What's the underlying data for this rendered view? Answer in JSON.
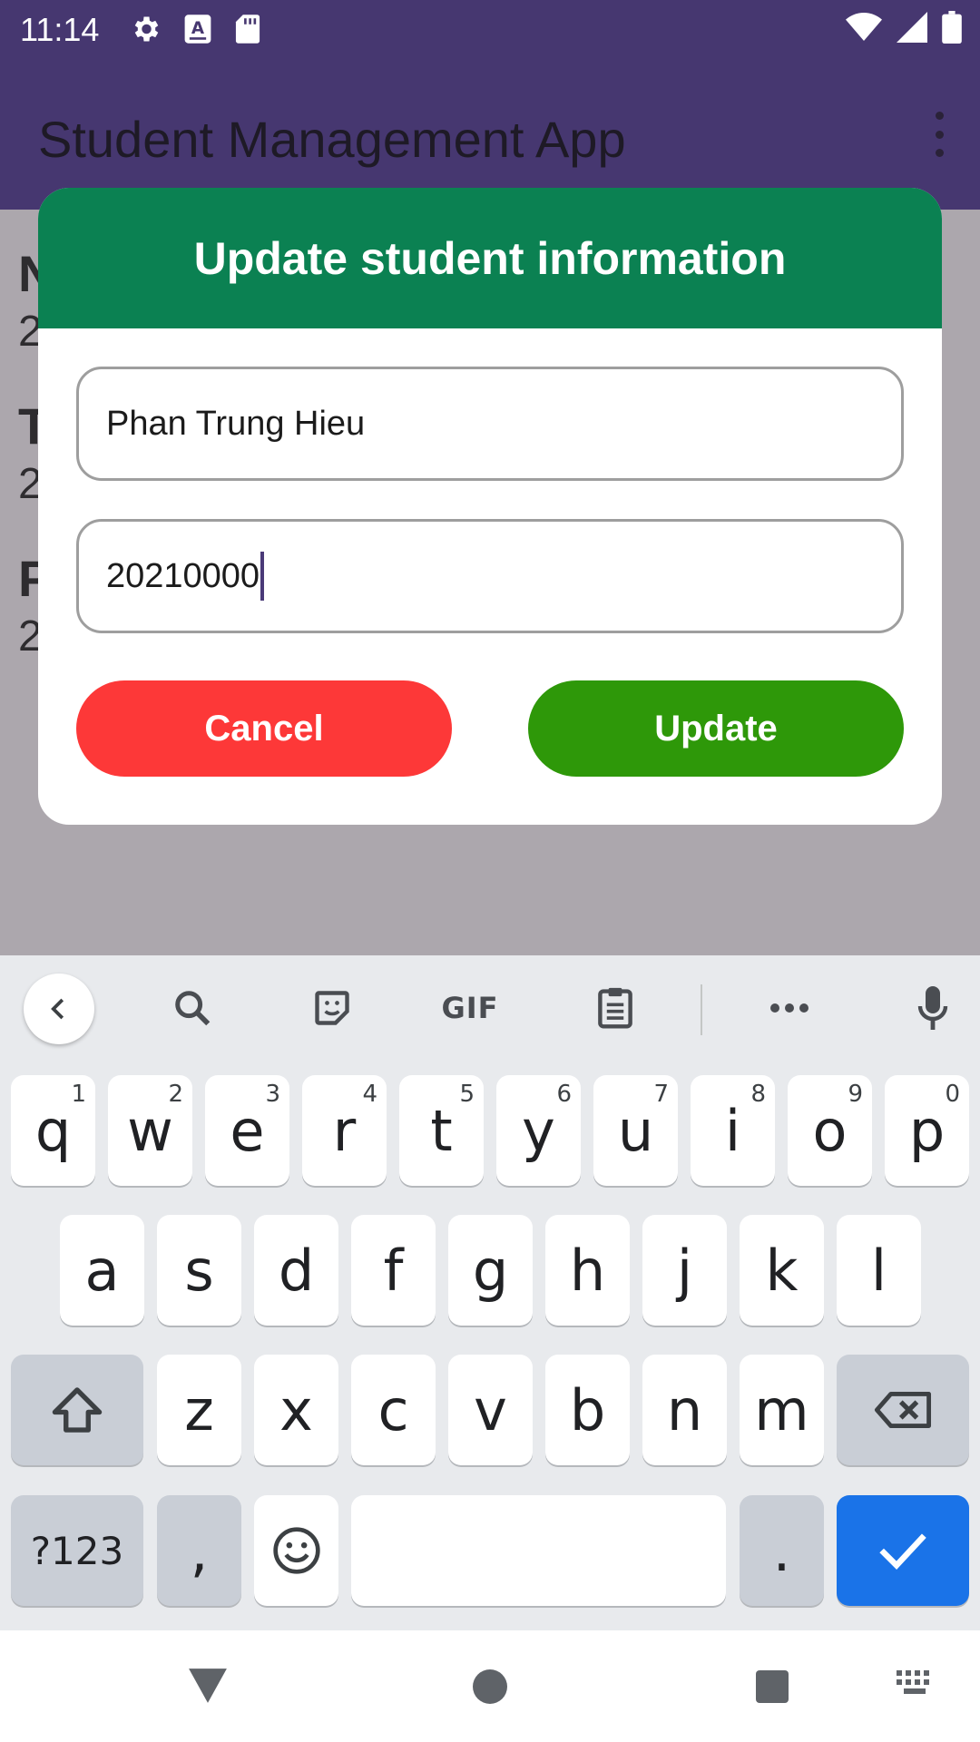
{
  "status_bar": {
    "time": "11:14",
    "left_icons": [
      "settings-icon",
      "keyboard-a-icon",
      "sd-card-icon"
    ],
    "right_icons": [
      "wifi-icon",
      "signal-icon",
      "battery-icon"
    ]
  },
  "app_bar": {
    "title": "Student Management App",
    "menu_icon": "overflow-menu-icon"
  },
  "background_list": [
    {
      "title": "N",
      "subtitle": "2"
    },
    {
      "title": "T",
      "subtitle": "2"
    },
    {
      "title": "P",
      "subtitle": "2"
    }
  ],
  "dialog": {
    "title": "Update student information",
    "name_value": "Phan Trung Hieu",
    "id_value": "20210000",
    "cancel_label": "Cancel",
    "update_label": "Update"
  },
  "keyboard": {
    "toolbar": {
      "back_icon": "chevron-left-icon",
      "items": [
        "search-icon",
        "sticker-icon",
        "GIF",
        "clipboard-icon",
        "more-icon",
        "mic-icon"
      ]
    },
    "row1": [
      {
        "label": "q",
        "hint": "1"
      },
      {
        "label": "w",
        "hint": "2"
      },
      {
        "label": "e",
        "hint": "3"
      },
      {
        "label": "r",
        "hint": "4"
      },
      {
        "label": "t",
        "hint": "5"
      },
      {
        "label": "y",
        "hint": "6"
      },
      {
        "label": "u",
        "hint": "7"
      },
      {
        "label": "i",
        "hint": "8"
      },
      {
        "label": "o",
        "hint": "9"
      },
      {
        "label": "p",
        "hint": "0"
      }
    ],
    "row2": [
      "a",
      "s",
      "d",
      "f",
      "g",
      "h",
      "j",
      "k",
      "l"
    ],
    "row3": [
      "z",
      "x",
      "c",
      "v",
      "b",
      "n",
      "m"
    ],
    "symbols_label": "?123",
    "comma_label": ",",
    "period_label": ".",
    "colors": {
      "enter": "#1a73e8",
      "key": "#ffffff",
      "mod": "#c9ced6"
    }
  },
  "nav_bar": {
    "icons": [
      "back-icon",
      "home-icon",
      "recents-icon",
      "keyboard-switch-icon"
    ]
  },
  "colors": {
    "app_bar": "#463770",
    "dialog_header": "#0b8152",
    "cancel": "#fd3838",
    "update": "#2e9809"
  }
}
